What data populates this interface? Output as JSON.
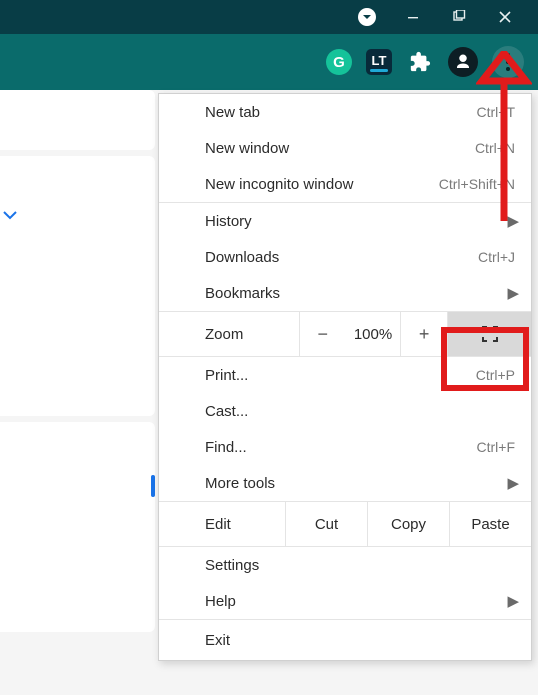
{
  "titlebar": {
    "minimize_tooltip": "Minimize",
    "maximize_tooltip": "Maximize",
    "close_tooltip": "Close"
  },
  "toolbar": {
    "grammarly": "G",
    "lt": "LT",
    "extensions_tooltip": "Extensions",
    "profile_tooltip": "Profile",
    "menu_tooltip": "Customize and control"
  },
  "menu": {
    "new_tab": {
      "label": "New tab",
      "shortcut": "Ctrl+T"
    },
    "new_window": {
      "label": "New window",
      "shortcut": "Ctrl+N"
    },
    "new_incognito": {
      "label": "New incognito window",
      "shortcut": "Ctrl+Shift+N"
    },
    "history": {
      "label": "History"
    },
    "downloads": {
      "label": "Downloads",
      "shortcut": "Ctrl+J"
    },
    "bookmarks": {
      "label": "Bookmarks"
    },
    "zoom": {
      "label": "Zoom",
      "minus": "−",
      "value": "100%",
      "plus": "+"
    },
    "print": {
      "label": "Print...",
      "shortcut": "Ctrl+P"
    },
    "cast": {
      "label": "Cast..."
    },
    "find": {
      "label": "Find...",
      "shortcut": "Ctrl+F"
    },
    "more_tools": {
      "label": "More tools"
    },
    "edit": {
      "label": "Edit",
      "cut": "Cut",
      "copy": "Copy",
      "paste": "Paste"
    },
    "settings": {
      "label": "Settings"
    },
    "help": {
      "label": "Help"
    },
    "exit": {
      "label": "Exit"
    }
  }
}
